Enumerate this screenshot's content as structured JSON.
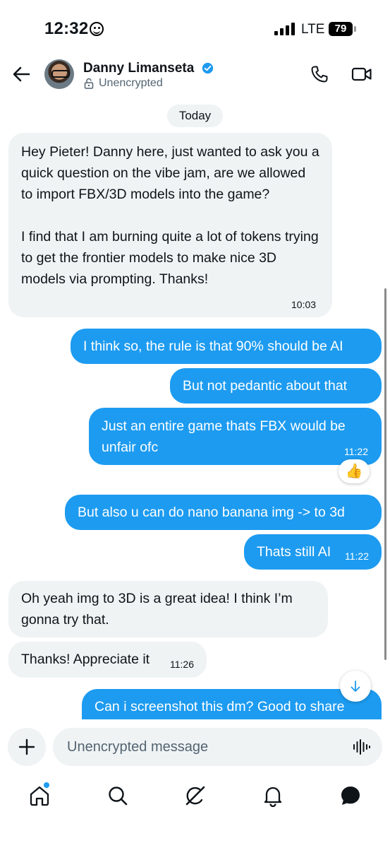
{
  "status_bar": {
    "time": "12:32",
    "network": "LTE",
    "battery": "79"
  },
  "header": {
    "name": "Danny Limanseta",
    "encryption": "Unencrypted"
  },
  "date_separator": "Today",
  "messages": [
    {
      "direction": "incoming",
      "text": "Hey Pieter! Danny here, just wanted to ask you a quick question on the vibe jam, are we allowed to import FBX/3D models into the game?\n\nI find that I am burning quite a lot of tokens trying to get the frontier models to make nice 3D models via prompting. Thanks!",
      "time": "10:03"
    },
    {
      "direction": "outgoing",
      "text": "I think so, the rule is that 90% should be AI",
      "time": ""
    },
    {
      "direction": "outgoing",
      "text": "But not pedantic about that",
      "time": ""
    },
    {
      "direction": "outgoing",
      "text": "Just an entire game thats FBX would be unfair ofc",
      "time": "11:22",
      "reaction": "👍"
    },
    {
      "direction": "outgoing",
      "text": "But also u can do nano banana img -> to 3d",
      "time": ""
    },
    {
      "direction": "outgoing",
      "text": "Thats still AI",
      "time": "11:22"
    },
    {
      "direction": "incoming",
      "text": "Oh yeah img to 3D is a great idea! I think I’m gonna try that.",
      "time": ""
    },
    {
      "direction": "incoming",
      "text": "Thanks! Appreciate it",
      "time": "11:26"
    },
    {
      "direction": "outgoing",
      "text": "Can i screenshot this dm? Good to share",
      "time": ""
    }
  ],
  "composer": {
    "placeholder": "Unencrypted message"
  },
  "colors": {
    "accent": "#1d9bf0",
    "incoming_bubble": "#eff3f4",
    "text_primary": "#0f1419",
    "text_secondary": "#536471"
  },
  "icons": {
    "back": "arrow-left-icon",
    "verified": "verified-badge-icon",
    "lock": "lock-icon",
    "call": "phone-icon",
    "video": "video-camera-icon",
    "add": "plus-icon",
    "voice": "voice-wave-icon",
    "scroll": "arrow-down-icon",
    "nav": [
      "home-icon",
      "search-icon",
      "grok-icon",
      "bell-icon",
      "messages-icon"
    ]
  }
}
